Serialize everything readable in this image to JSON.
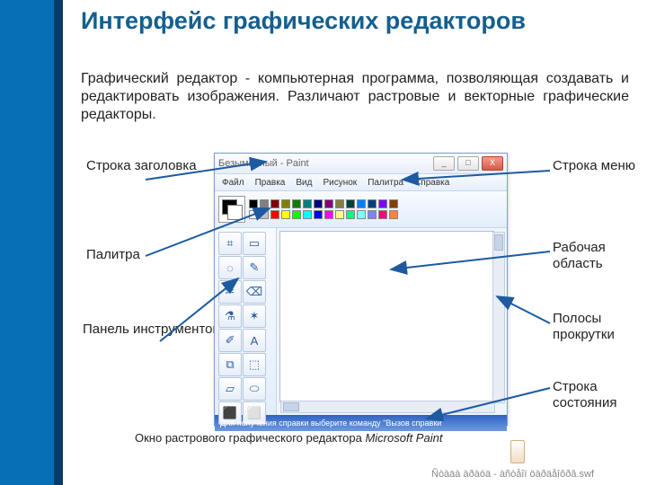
{
  "title": "Интерфейс графических редакторов",
  "description": "Графический редактор - компьютерная программа, позволяющая создавать и редактировать изображения. Различают растровые и векторные графические редакторы.",
  "labels": {
    "titlebar": "Строка заголовка",
    "palette": "Палитра",
    "toolbox": "Панель инструментов",
    "menubar": "Строка меню",
    "workarea": "Рабочая область",
    "scrollbars": "Полосы прокрутки",
    "statusbar": "Строка состояния"
  },
  "paint": {
    "title": "Безымянный - Paint",
    "menu": [
      "Файл",
      "Правка",
      "Вид",
      "Рисунок",
      "Палитра",
      "Справка"
    ],
    "status": "Для получения справки выберите команду \"Вызов справки\"",
    "window_buttons": {
      "min": "_",
      "max": "□",
      "close": "X"
    },
    "colors_row1": [
      "#000000",
      "#808080",
      "#800000",
      "#808000",
      "#008000",
      "#008080",
      "#000080",
      "#800080",
      "#808040",
      "#004040",
      "#0080ff",
      "#004080",
      "#8000ff",
      "#804000"
    ],
    "colors_row2": [
      "#ffffff",
      "#c0c0c0",
      "#ff0000",
      "#ffff00",
      "#00ff00",
      "#00ffff",
      "#0000ff",
      "#ff00ff",
      "#ffff80",
      "#00ff80",
      "#80ffff",
      "#8080ff",
      "#ff0080",
      "#ff8040"
    ],
    "tools": [
      "⌗",
      "▭",
      "◌",
      "✎",
      "✂",
      "⌫",
      "⚗",
      "✶",
      "✐",
      "A",
      "⧉",
      "⬚",
      "▱",
      "⬭",
      "⬛",
      "⬜"
    ]
  },
  "caption_prefix": "Окно растрового графического редактора ",
  "caption_em": "Microsoft Paint",
  "garbled": "Ñòàäà àðàóä - àñòåîï öàðäåîôðâ.swf"
}
